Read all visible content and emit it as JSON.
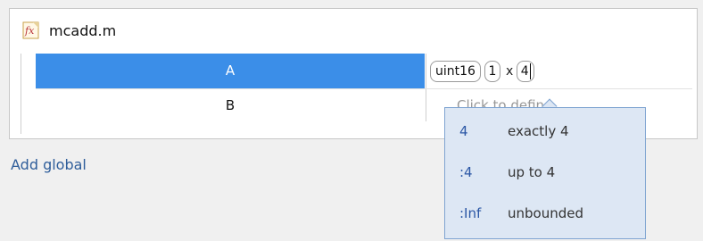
{
  "file": {
    "name": "mcadd.m",
    "icon": "fx-function-icon"
  },
  "table": {
    "rows": [
      {
        "name": "A",
        "selected": true,
        "type_editor": {
          "class": "uint16",
          "dim1": "1",
          "separator": "x",
          "dim2": "4"
        }
      },
      {
        "name": "B",
        "value_placeholder": "Click to define"
      }
    ]
  },
  "actions": {
    "add_global": "Add global"
  },
  "size_popup": {
    "options": [
      {
        "key": "4",
        "desc": "exactly 4"
      },
      {
        "key": ":4",
        "desc": "up to 4"
      },
      {
        "key": ":Inf",
        "desc": "unbounded"
      }
    ]
  },
  "colors": {
    "selection": "#3b8ee8",
    "link": "#2e5d9a",
    "popup_bg": "#dde7f4",
    "popup_key": "#2b57a5"
  }
}
